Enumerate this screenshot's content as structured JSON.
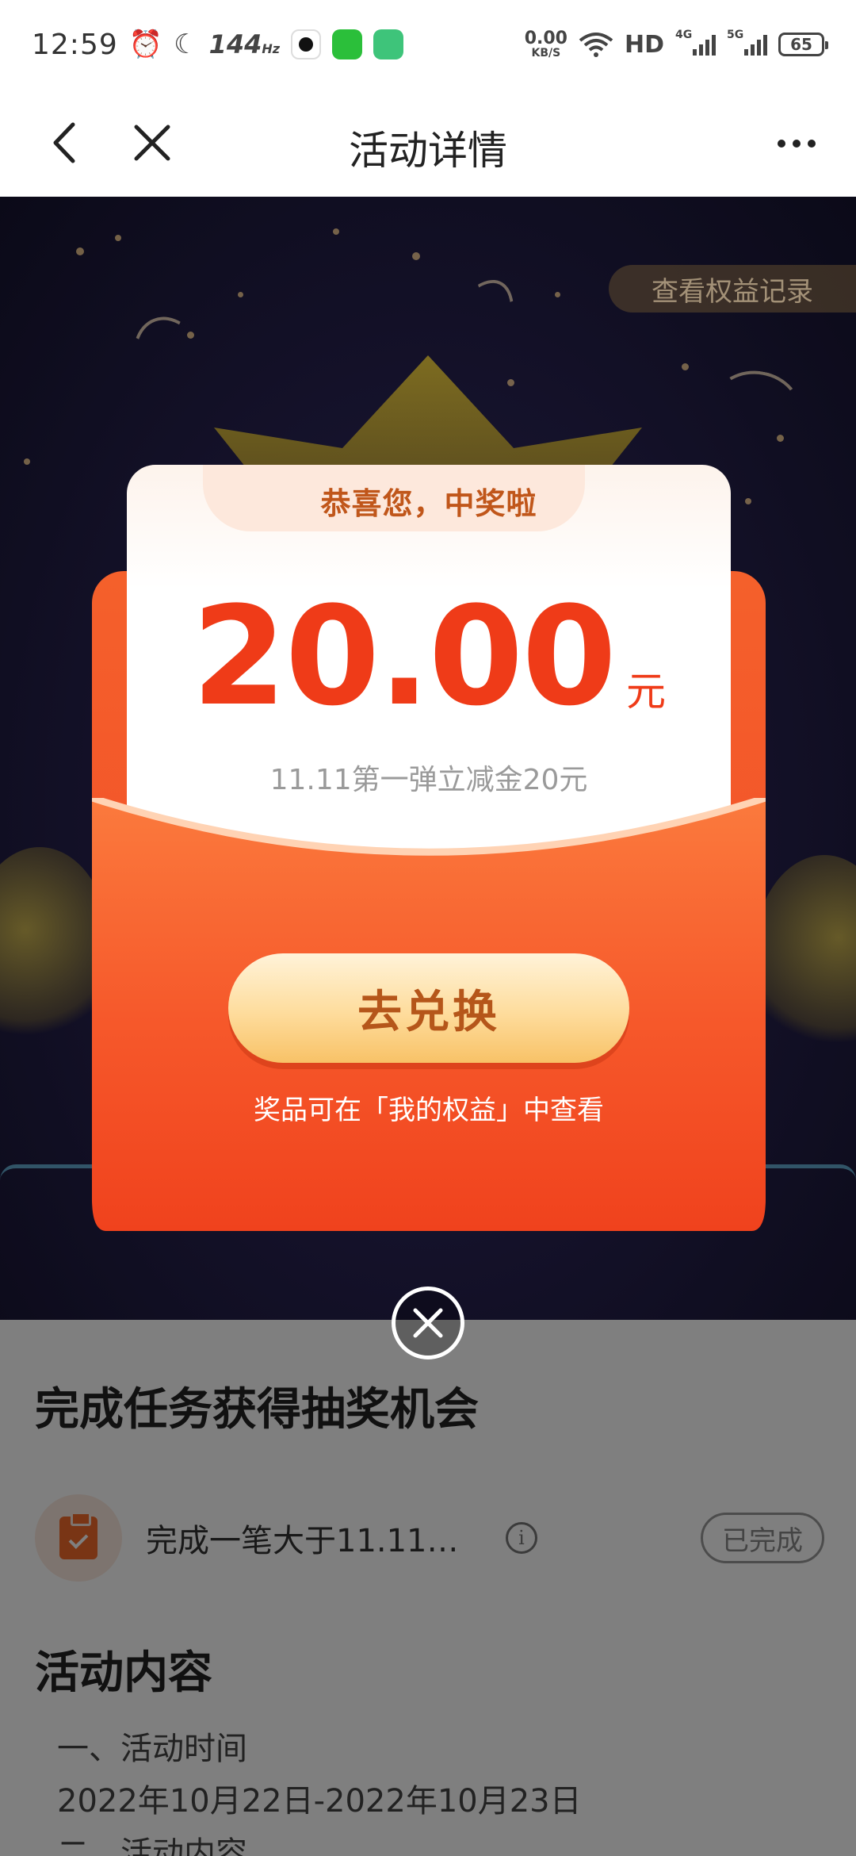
{
  "status_bar": {
    "time": "12:59",
    "refresh_rate": "144",
    "refresh_unit": "Hz",
    "net_speed_value": "0.00",
    "net_speed_unit": "KB/S",
    "hd_label": "HD",
    "signal_4g": "4G",
    "signal_5g": "5G",
    "battery": "65"
  },
  "nav": {
    "title": "活动详情"
  },
  "hero": {
    "rights_record_label": "查看权益记录"
  },
  "prize": {
    "congrats": "恭喜您，中奖啦",
    "amount": "20.00",
    "unit": "元",
    "description": "11.11第一弹立减金20元",
    "redeem_label": "去兑换",
    "hint": "奖品可在「我的权益」中查看"
  },
  "content": {
    "task_section_title": "完成任务获得抽奖机会",
    "task": {
      "text": "完成一笔大于11.11元…",
      "status": "已完成",
      "info_icon": "i"
    },
    "activity_section_title": "活动内容",
    "lines": [
      "一、活动时间",
      "2022年10月22日-2022年10月23日",
      "二、活动内容"
    ]
  },
  "colors": {
    "accent_red": "#ef3b18",
    "card_orange": "#f4602b",
    "button_gold": "#fedc9c",
    "button_text": "#b5561a"
  },
  "icons": {
    "back": "chevron-left-icon",
    "close": "close-icon",
    "more": "more-horizontal-icon",
    "dialog_close": "close-circle-icon",
    "task": "clipboard-check-icon",
    "info": "info-icon"
  }
}
